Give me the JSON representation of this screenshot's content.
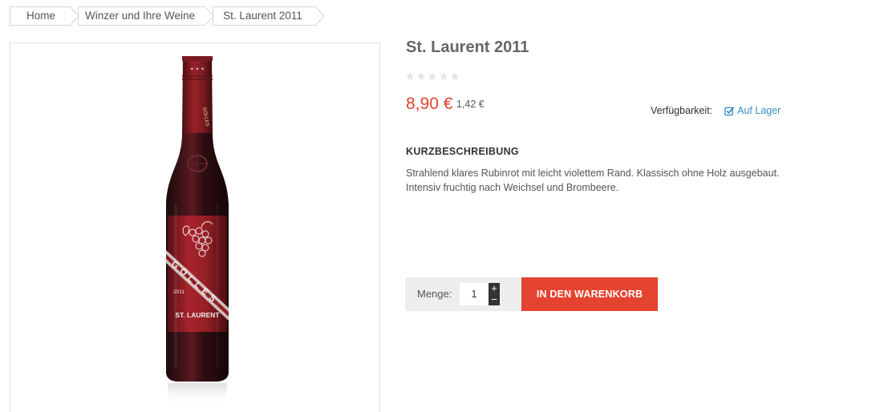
{
  "breadcrumb": {
    "items": [
      {
        "label": "Home"
      },
      {
        "label": "Winzer und Ihre Weine"
      },
      {
        "label": "St. Laurent 2011"
      }
    ]
  },
  "product": {
    "title": "St. Laurent 2011",
    "rating": 0,
    "rating_max": 5,
    "price": "8,90 €",
    "base_price": "1,42 €",
    "availability_label": "Verfügbarkeit:",
    "availability_status": "Auf Lager",
    "short_description_heading": "KURZBESCHREIBUNG",
    "short_description": "Strahlend klares Rubinrot mit leicht violettem Rand. Klassisch ohne Holz ausgebaut. Intensiv fruchtig nach Weichsel und Brombeere.",
    "bottle_label": {
      "brand": "GÖLLES",
      "year": "2011",
      "variety": "ST. LAURENT"
    }
  },
  "cart": {
    "quantity_label": "Menge:",
    "quantity_value": "1",
    "plus_symbol": "+",
    "minus_symbol": "−",
    "add_to_cart_label": "IN DEN WARENKORB"
  },
  "colors": {
    "accent": "#e4432f",
    "link": "#3b8fc8",
    "wine": "#8e1f24"
  },
  "icons": {
    "rating": "star-icon",
    "availability": "checkbox-check-icon"
  }
}
